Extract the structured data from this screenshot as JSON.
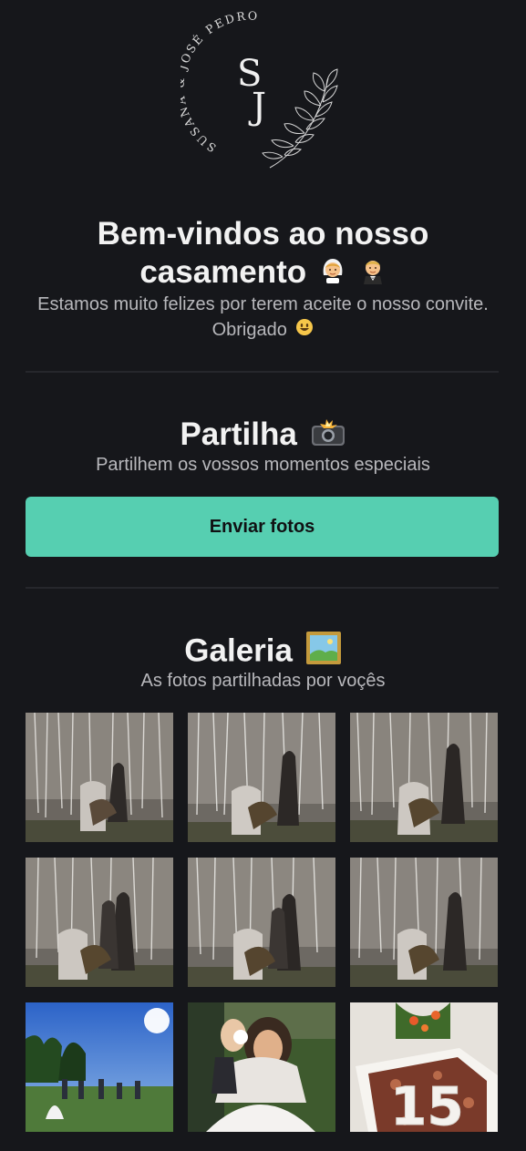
{
  "logo": {
    "monogram": "SJ",
    "arc_text": "SUSANA & JOSÉ PEDRO"
  },
  "welcome": {
    "title": "Bem-vindos ao nosso casamento",
    "title_emoji": [
      "bride-emoji",
      "groom-emoji"
    ],
    "subtitle": "Estamos muito felizes por terem aceite o nosso convite. Obrigado",
    "subtitle_emoji": "smiley-emoji"
  },
  "share": {
    "title": "Partilha",
    "title_emoji": "camera-flash-emoji",
    "subtitle": "Partilhem os vossos momentos especiais",
    "button_label": "Enviar fotos"
  },
  "gallery": {
    "title": "Galeria",
    "title_emoji": "framed-picture-emoji",
    "subtitle": "As fotos partilhadas por voçês",
    "photos": [
      {
        "kind": "sparklers"
      },
      {
        "kind": "sparklers"
      },
      {
        "kind": "sparklers"
      },
      {
        "kind": "sparklers"
      },
      {
        "kind": "sparklers"
      },
      {
        "kind": "sparklers"
      },
      {
        "kind": "garden"
      },
      {
        "kind": "hug"
      },
      {
        "kind": "cake15"
      }
    ]
  },
  "colors": {
    "background": "#16171b",
    "accent": "#56cfb1",
    "divider": "#26272c"
  }
}
